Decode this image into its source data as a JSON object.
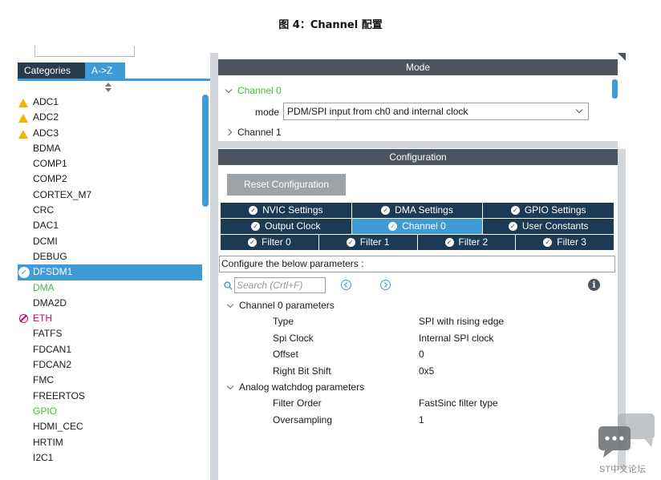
{
  "caption": "图 4：Channel 配置",
  "sidebar": {
    "tab_categories": "Categories",
    "tab_az": "A->Z",
    "items": [
      {
        "label": "ADC1",
        "status": "warning"
      },
      {
        "label": "ADC2",
        "status": "warning"
      },
      {
        "label": "ADC3",
        "status": "warning"
      },
      {
        "label": "BDMA",
        "status": "none"
      },
      {
        "label": "COMP1",
        "status": "none"
      },
      {
        "label": "COMP2",
        "status": "none"
      },
      {
        "label": "CORTEX_M7",
        "status": "none"
      },
      {
        "label": "CRC",
        "status": "none"
      },
      {
        "label": "DAC1",
        "status": "none"
      },
      {
        "label": "DCMI",
        "status": "none"
      },
      {
        "label": "DEBUG",
        "status": "none"
      },
      {
        "label": "DFSDM1",
        "status": "selected-ok"
      },
      {
        "label": "DMA",
        "status": "configured"
      },
      {
        "label": "DMA2D",
        "status": "none"
      },
      {
        "label": "ETH",
        "status": "blocked"
      },
      {
        "label": "FATFS",
        "status": "none"
      },
      {
        "label": "FDCAN1",
        "status": "none"
      },
      {
        "label": "FDCAN2",
        "status": "none"
      },
      {
        "label": "FMC",
        "status": "none"
      },
      {
        "label": "FREERTOS",
        "status": "none"
      },
      {
        "label": "GPIO",
        "status": "configured"
      },
      {
        "label": "HDMI_CEC",
        "status": "none"
      },
      {
        "label": "HRTIM",
        "status": "none"
      },
      {
        "label": "I2C1",
        "status": "none"
      }
    ]
  },
  "mode": {
    "header": "Mode",
    "channel0": "Channel 0",
    "mode_label": "mode",
    "mode_value": "PDM/SPI input from ch0 and internal clock",
    "channel1": "Channel 1"
  },
  "configuration": {
    "header": "Configuration",
    "reset_button": "Reset Configuration",
    "tabs_row1": [
      "NVIC Settings",
      "DMA Settings",
      "GPIO Settings"
    ],
    "tabs_row2": [
      "Output Clock",
      "Channel 0",
      "User Constants"
    ],
    "tabs_row3": [
      "Filter 0",
      "Filter 1",
      "Filter 2",
      "Filter 3"
    ],
    "active_tab": "Channel 0",
    "configure_text": "Configure the below parameters :",
    "search_placeholder": "Search (Crtl+F)",
    "groups": [
      {
        "title": "Channel 0 parameters",
        "params": [
          {
            "name": "Type",
            "value": "SPI with rising edge"
          },
          {
            "name": "Spi Clock",
            "value": "Internal SPI clock"
          },
          {
            "name": "Offset",
            "value": "0"
          },
          {
            "name": "Right Bit Shift",
            "value": "0x5"
          }
        ]
      },
      {
        "title": "Analog watchdog parameters",
        "params": [
          {
            "name": "Filter Order",
            "value": "FastSinc filter type"
          },
          {
            "name": "Oversampling",
            "value": "1"
          }
        ]
      }
    ]
  },
  "watermark": "ST中文论坛",
  "colors": {
    "accent_blue": "#3f9bd6",
    "tab_dark": "#1c3a56",
    "header_gray": "#4b5560",
    "status_green": "#4bb543",
    "warning_yellow": "#f2b400",
    "blocked_magenta": "#d0006f"
  }
}
